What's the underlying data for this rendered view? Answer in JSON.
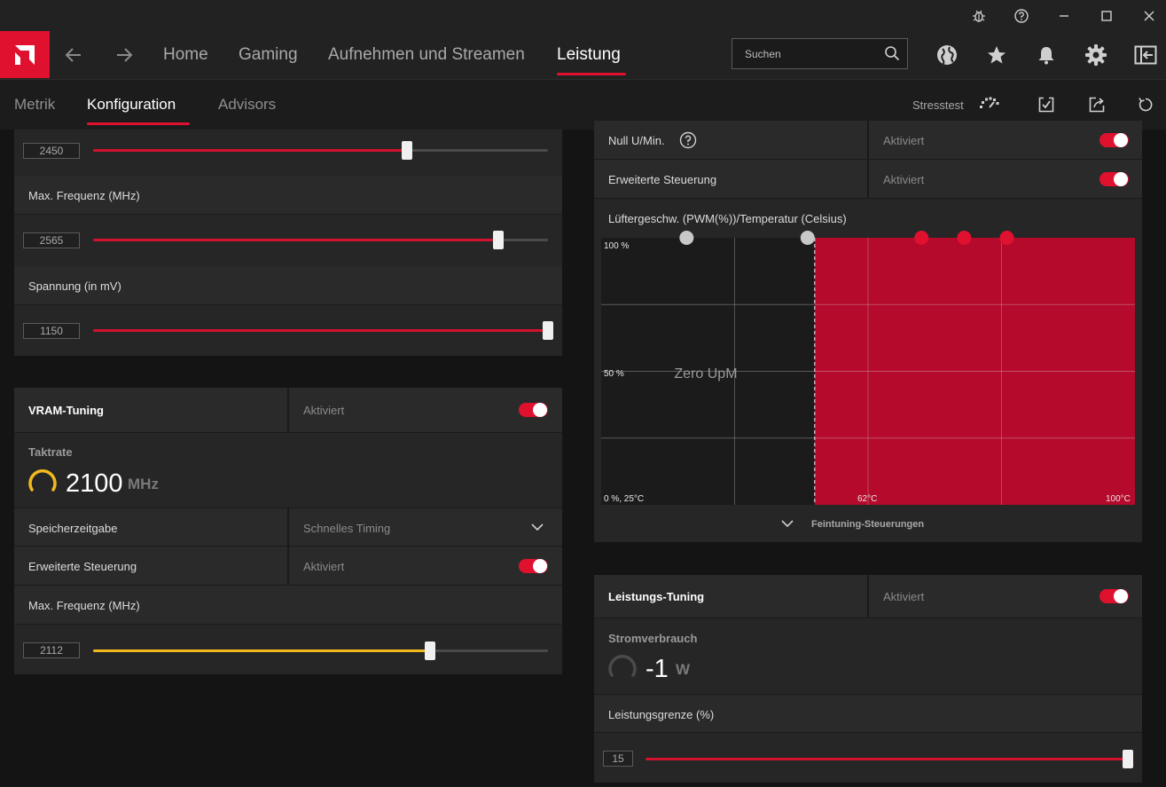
{
  "nav": {
    "tabs": [
      "Home",
      "Gaming",
      "Aufnehmen und Streamen",
      "Leistung"
    ],
    "active": "Leistung",
    "search_placeholder": "Suchen"
  },
  "subnav": {
    "tabs": [
      "Metrik",
      "Konfiguration",
      "Advisors"
    ],
    "active": "Konfiguration",
    "stresstest_label": "Stresstest"
  },
  "gpu_tuning": {
    "slider1": {
      "value": "2450",
      "fraction": 0.69
    },
    "max_freq": {
      "label": "Max. Frequenz (MHz)",
      "value": "2565",
      "fraction": 0.89
    },
    "voltage": {
      "label": "Spannung (in mV)",
      "value": "1150",
      "fraction": 1.0
    }
  },
  "vram_tuning": {
    "title": "VRAM-Tuning",
    "status": "Aktiviert",
    "enabled": true,
    "clock_label": "Taktrate",
    "clock_value": "2100",
    "clock_unit": "MHz",
    "timing_label": "Speicherzeitgabe",
    "timing_value": "Schnelles Timing",
    "advanced_label": "Erweiterte Steuerung",
    "advanced_status": "Aktiviert",
    "advanced_enabled": true,
    "max_freq_label": "Max. Frequenz (MHz)",
    "max_freq_value": "2112",
    "max_freq_fraction": 0.74
  },
  "fan_tuning": {
    "zero_rpm_label": "Null U/Min.",
    "zero_rpm_status": "Aktiviert",
    "zero_rpm_enabled": true,
    "advanced_label": "Erweiterte Steuerung",
    "advanced_status": "Aktiviert",
    "advanced_enabled": true,
    "chart_title": "Lüftergeschw. (PWM(%))/Temperatur (Celsius)",
    "zero_rpm_overlay": "Zero UpM",
    "fine_tuning_label": "Feintuning-Steuerungen"
  },
  "chart_data": {
    "type": "line",
    "title": "Lüftergeschw. (PWM(%))/Temperatur (Celsius)",
    "xlim": [
      25,
      100
    ],
    "ylim": [
      0,
      100
    ],
    "y_tick_labels": [
      "100 %",
      "50 %",
      "0 %, 25°C"
    ],
    "x_tick_labels": [
      "62°C",
      "100°C"
    ],
    "zero_rpm_threshold": 55,
    "annotation": "Zero UpM",
    "points": [
      {
        "x": 37,
        "y": 100,
        "color": "#c8c8c8"
      },
      {
        "x": 54,
        "y": 100,
        "color": "#c8c8c8"
      },
      {
        "x": 70,
        "y": 100,
        "color": "#e0102f"
      },
      {
        "x": 76,
        "y": 100,
        "color": "#e0102f"
      },
      {
        "x": 82,
        "y": 100,
        "color": "#e0102f"
      }
    ]
  },
  "power_tuning": {
    "title": "Leistungs-Tuning",
    "status": "Aktiviert",
    "enabled": true,
    "power_label": "Stromverbrauch",
    "power_value": "-1",
    "power_unit": "W",
    "limit_label": "Leistungsgrenze (%)",
    "limit_value": "15",
    "limit_fraction": 1.0
  },
  "colors": {
    "accent": "#e0102f",
    "yellow": "#f2b91f"
  }
}
